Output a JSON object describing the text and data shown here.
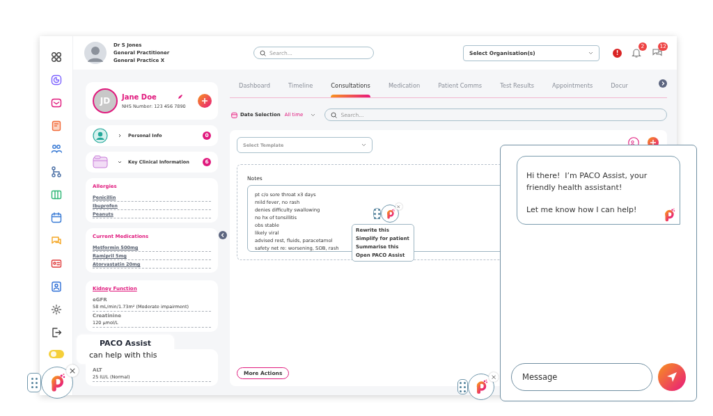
{
  "header": {
    "user_name": "Dr S Jones",
    "user_role": "General Practitioner",
    "user_practice": "General Practice X",
    "search": {
      "placeholder": "Search..."
    },
    "organisation_select": {
      "placeholder": "Select Organisation(s)"
    },
    "alert_badge": "!",
    "notification_count": "2",
    "message_count": "12"
  },
  "sidebar": {
    "theme_toggle": {
      "on": false
    }
  },
  "patient": {
    "initials": "JD",
    "name": "Jane Doe",
    "nhs_number": "NHS Number: 123 456 7890"
  },
  "sections": [
    {
      "label": "Personal Info",
      "count": "0",
      "expanded": false
    },
    {
      "label": "Key Clinical Information",
      "count": "6",
      "expanded": true
    }
  ],
  "allergies": {
    "title": "Allergies",
    "items": [
      "Penicillin",
      "Ibuprofen",
      "Peanuts"
    ]
  },
  "medications": {
    "title": "Current Medications",
    "items": [
      "Metformin 500mg",
      "Ramipril 5mg",
      "Atorvastatin 20mg"
    ]
  },
  "kidney_function": {
    "title": "Kidney Function",
    "entries": [
      {
        "label": "eGFR",
        "value": "58 mL/min/1.73m² (Moderate impairment)"
      },
      {
        "label": "Creatinine",
        "value": "120 µmol/L"
      }
    ]
  },
  "liver_function": {
    "entries": [
      {
        "label": "ALT",
        "value": "25 IU/L (Normal)"
      }
    ]
  },
  "tabs": [
    {
      "label": "Dashboard",
      "selected": false
    },
    {
      "label": "Timeline",
      "selected": false
    },
    {
      "label": "Consultations",
      "selected": true
    },
    {
      "label": "Medication",
      "selected": false
    },
    {
      "label": "Patient Comms",
      "selected": false
    },
    {
      "label": "Test Results",
      "selected": false
    },
    {
      "label": "Appointments",
      "selected": false
    },
    {
      "label": "Docur",
      "selected": false
    }
  ],
  "filter": {
    "label": "Date Selection",
    "value": "All time",
    "search": {
      "placeholder": "Search..."
    }
  },
  "consultation": {
    "template_select": {
      "placeholder": "Select Template"
    },
    "notes_label": "Notes",
    "notes": [
      "pt c/o sore throat x3 days",
      "mild fever, no rash",
      "denies difficulty swallowing",
      "no hx of tonsillitis",
      "obs stable",
      "likely viral",
      "advised rest, fluids, paracetamol",
      "safety net re: worsening, SOB, rash"
    ],
    "more_actions": "More Actions"
  },
  "context_menu": [
    "Rewrite this",
    "Simplify for patient",
    "Summarise this",
    "Open PACO Assist"
  ],
  "chat": {
    "messages": [
      "Hi there!  I’m PACO Assist, your friendly health assistant!",
      "Let me know how I can help!"
    ],
    "input": {
      "placeholder": "Message"
    }
  },
  "tooltip": {
    "title": "PACO Assist",
    "text": "can help with this"
  }
}
